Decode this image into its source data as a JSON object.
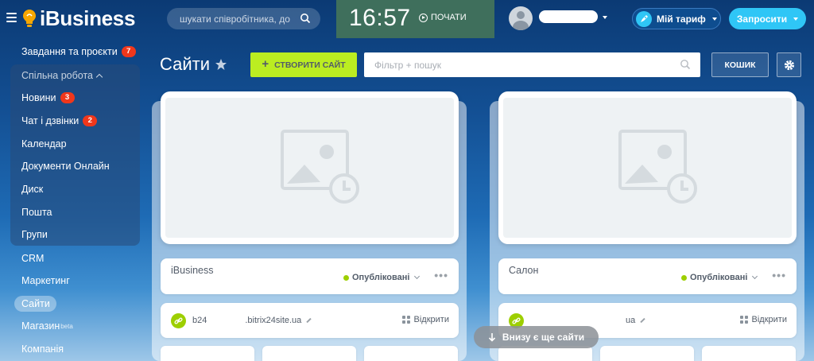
{
  "header": {
    "logo": "iBusiness",
    "search_placeholder": "шукати співробітника, до...",
    "clock": "16:57",
    "start_label": "ПОЧАТИ",
    "tariff_label": "Мій тариф",
    "invite_label": "Запросити"
  },
  "sidebar": {
    "tasks": {
      "label": "Завдання та проєкти",
      "badge": "7"
    },
    "group": {
      "title": "Спільна робота"
    },
    "items": [
      {
        "label": "Новини",
        "badge": "3"
      },
      {
        "label": "Чат і дзвінки",
        "badge": "2"
      },
      {
        "label": "Календар"
      },
      {
        "label": "Документи Онлайн"
      },
      {
        "label": "Диск"
      },
      {
        "label": "Пошта"
      },
      {
        "label": "Групи"
      }
    ],
    "crm": "CRM",
    "marketing": "Маркетинг",
    "sites": "Сайти",
    "shops": "Магазин",
    "shops_sup": "beta",
    "company": "Компанія"
  },
  "page": {
    "title": "Сайти",
    "create_label": "СТВОРИТИ САЙТ",
    "filter_placeholder": "Фільтр + пошук",
    "trash_label": "КОШИК"
  },
  "sites": [
    {
      "name": "iBusiness",
      "status": "Опубліковані",
      "url_prefix": "b24",
      "url_suffix": ".bitrix24site.ua",
      "open_label": "Відкрити"
    },
    {
      "name": "Салон",
      "status": "Опубліковані",
      "url_prefix": "",
      "url_suffix": "ua",
      "open_label": "Відкрити"
    }
  ],
  "more_sites_label": "Внизу є ще сайти",
  "colors": {
    "accent_green": "#bbed21",
    "invite_blue": "#2fc6f6",
    "badge_red": "#f0371b",
    "published_dot": "#9dcf00"
  },
  "icons": [
    "menu-icon",
    "bulb-icon",
    "search-icon",
    "play-icon",
    "rocket-icon",
    "star-icon",
    "gear-icon",
    "image-placeholder-icon",
    "link-icon",
    "pencil-icon",
    "grid-icon",
    "arrow-down-icon"
  ]
}
